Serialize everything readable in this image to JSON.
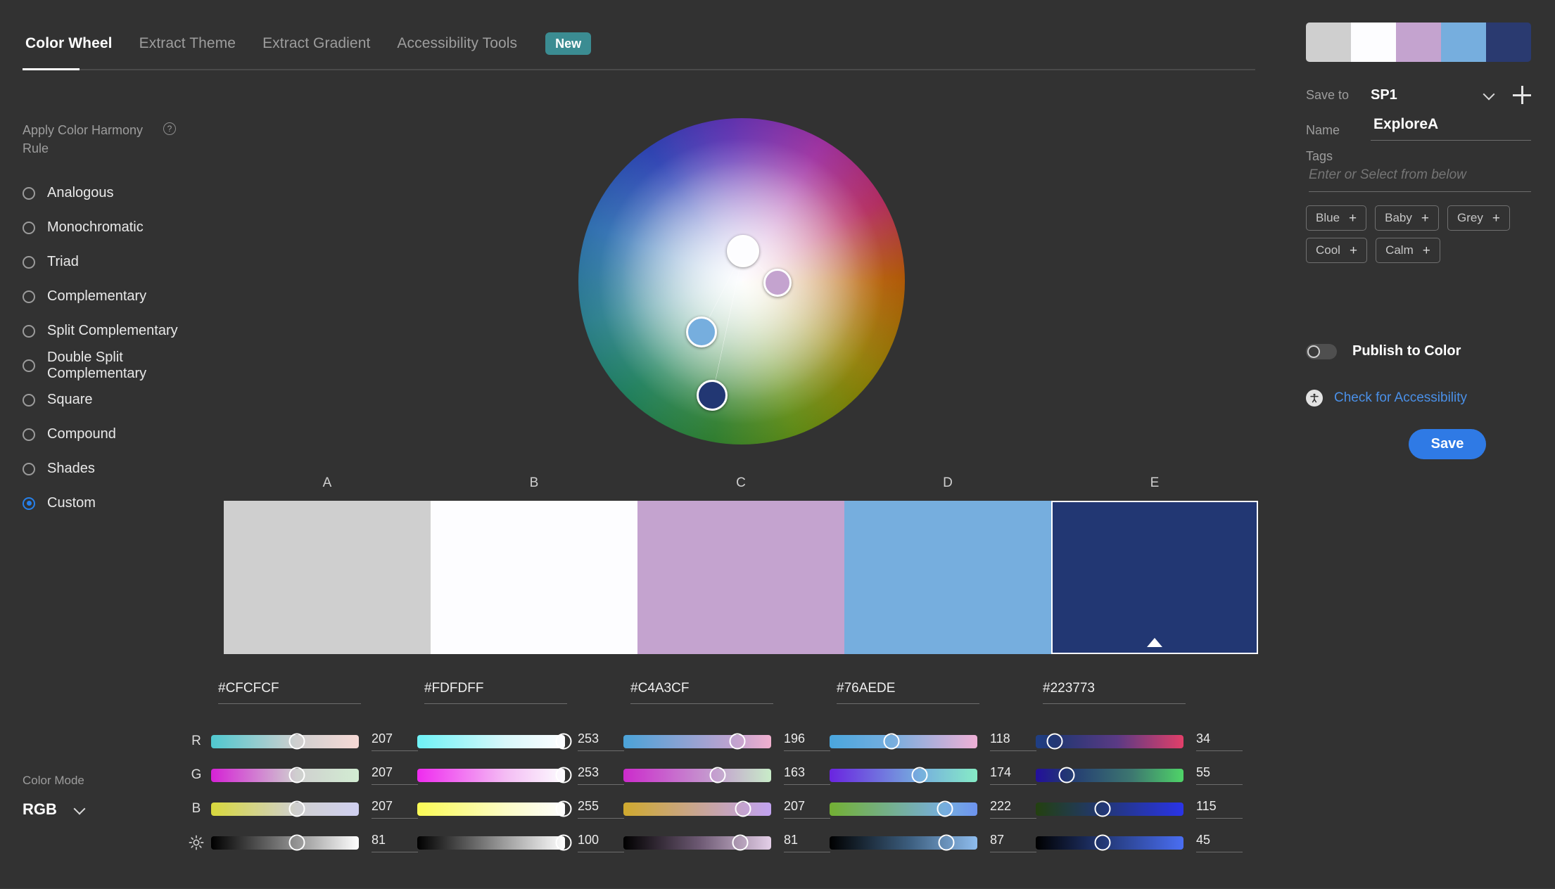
{
  "tabs": [
    {
      "label": "Color Wheel",
      "active": true
    },
    {
      "label": "Extract Theme",
      "active": false
    },
    {
      "label": "Extract Gradient",
      "active": false
    },
    {
      "label": "Accessibility Tools",
      "active": false
    }
  ],
  "tab_badge": "New",
  "harmony": {
    "title": "Apply Color Harmony Rule",
    "help_icon": "?",
    "rules": [
      {
        "label": "Analogous",
        "selected": false
      },
      {
        "label": "Monochromatic",
        "selected": false
      },
      {
        "label": "Triad",
        "selected": false
      },
      {
        "label": "Complementary",
        "selected": false
      },
      {
        "label": "Split Complementary",
        "selected": false
      },
      {
        "label": "Double Split Complementary",
        "selected": false
      },
      {
        "label": "Square",
        "selected": false
      },
      {
        "label": "Compound",
        "selected": false
      },
      {
        "label": "Shades",
        "selected": false
      },
      {
        "label": "Custom",
        "selected": true
      }
    ]
  },
  "color_mode": {
    "label": "Color Mode",
    "value": "RGB"
  },
  "wheel": {
    "markers": [
      {
        "name": "marker-b",
        "x": 50.5,
        "y": 40.8,
        "size": 46,
        "fill": "#fdfdff"
      },
      {
        "name": "marker-c",
        "x": 61.0,
        "y": 50.5,
        "size": 40,
        "fill": "#c4a3cf"
      },
      {
        "name": "marker-d",
        "x": 37.8,
        "y": 65.5,
        "size": 44,
        "fill": "#76aede"
      },
      {
        "name": "marker-e",
        "x": 41.0,
        "y": 85.0,
        "size": 44,
        "fill": "#223773"
      }
    ]
  },
  "swatches": [
    {
      "letter": "A",
      "hex": "#CFCFCF",
      "color": "#cfcfcf",
      "selected": false
    },
    {
      "letter": "B",
      "hex": "#FDFDFF",
      "color": "#fdfdff",
      "selected": false
    },
    {
      "letter": "C",
      "hex": "#C4A3CF",
      "color": "#c4a3cf",
      "selected": false
    },
    {
      "letter": "D",
      "hex": "#76AEDE",
      "color": "#76aede",
      "selected": false
    },
    {
      "letter": "E",
      "hex": "#223773",
      "color": "#223773",
      "selected": true
    }
  ],
  "sliders": {
    "channel_labels": [
      "R",
      "G",
      "B"
    ],
    "brightness_icon": "sun-icon",
    "columns": [
      {
        "letter": "A",
        "values": {
          "R": "207",
          "G": "207",
          "B": "207",
          "brightness": "81"
        },
        "positions": {
          "R": 58,
          "G": 58,
          "B": 58,
          "brightness": 58
        },
        "gradients": {
          "R": "linear-gradient(90deg,#4fc8cf 0%,#cfcfcf 58%,#f6d9d5 100%)",
          "G": "linear-gradient(90deg,#d521d5 0%,#cfcfcf 58%,#d2edd2 100%)",
          "B": "linear-gradient(90deg,#d8d83c 0%,#cfcfcf 58%,#cfcff0 100%)",
          "brightness": "linear-gradient(90deg,#000000 0%,#8c8c8c 55%,#ffffff 100%)"
        }
      },
      {
        "letter": "B",
        "values": {
          "R": "253",
          "G": "253",
          "B": "255",
          "brightness": "100"
        },
        "positions": {
          "R": 99,
          "G": 99,
          "B": 99,
          "brightness": 99
        },
        "gradients": {
          "R": "linear-gradient(90deg,#6ef2f6 0%,#d8f7fa 60%,#fdfdff 100%)",
          "G": "linear-gradient(90deg,#ef2bef 0%,#f4bdf4 60%,#fdfdff 100%)",
          "B": "linear-gradient(90deg,#fafa55 0%,#fcfcc6 60%,#fdfdff 100%)",
          "brightness": "linear-gradient(90deg,#000000 0%,#9a9a9a 58%,#ffffff 100%)"
        }
      },
      {
        "letter": "C",
        "values": {
          "R": "196",
          "G": "163",
          "B": "207",
          "brightness": "81"
        },
        "positions": {
          "R": 77,
          "G": 64,
          "B": 81,
          "brightness": 79
        },
        "gradients": {
          "R": "linear-gradient(90deg,#4ba3d8 0%,#c4a3cf 77%,#f0b0cf 100%)",
          "G": "linear-gradient(90deg,#cc2bcc 0%,#c4a3cf 64%,#c8ecc8 100%)",
          "B": "linear-gradient(90deg,#cfa92e 0%,#c4a3cf 81%,#c2a3f0 100%)",
          "brightness": "linear-gradient(90deg,#000000 0%,#6e5a74 52%,#e4cfe8 100%)"
        }
      },
      {
        "letter": "D",
        "values": {
          "R": "118",
          "G": "174",
          "B": "222",
          "brightness": "87"
        },
        "positions": {
          "R": 42,
          "G": 61,
          "B": 78,
          "brightness": 79
        },
        "gradients": {
          "R": "linear-gradient(90deg,#4aa6dd 0%,#76aede 42%,#efb0d6 100%)",
          "G": "linear-gradient(90deg,#6a24e0 0%,#76aede 61%,#86ecc6 100%)",
          "B": "linear-gradient(90deg,#73b033 0%,#76aede 78%,#6d93ef 100%)",
          "brightness": "linear-gradient(90deg,#000000 0%,#3d5f80 55%,#8fbdee 100%)"
        }
      },
      {
        "letter": "E",
        "values": {
          "R": "34",
          "G": "55",
          "B": "115",
          "brightness": "45"
        },
        "positions": {
          "R": 13,
          "G": 21,
          "B": 45,
          "brightness": 45
        },
        "gradients": {
          "R": "linear-gradient(90deg,#1f3f86 0%,#223773 13%,#5a3a84 55%,#e23f69 100%)",
          "G": "linear-gradient(90deg,#230f9c 0%,#223773 21%,#3d7770 65%,#4fd468 100%)",
          "B": "linear-gradient(90deg,#23400f 0%,#223773 45%,#2a34e8 100%)",
          "brightness": "linear-gradient(90deg,#000000 0%,#223773 45%,#4a6ef2 100%)"
        }
      }
    ]
  },
  "right_panel": {
    "thumb_colors": [
      "#cfcfcf",
      "#fdfdff",
      "#c4a3cf",
      "#76aede",
      "#2a3a70"
    ],
    "save_to_label": "Save to",
    "save_to_value": "SP1",
    "add_icon": "plus-icon",
    "name_label": "Name",
    "name_value": "ExploreA",
    "tags_label": "Tags",
    "tags_placeholder": "Enter or Select from below",
    "tag_chips": [
      "Blue",
      "Baby",
      "Grey",
      "Cool",
      "Calm"
    ],
    "chip_plus": "+",
    "publish_label": "Publish to Color",
    "publish_on": false,
    "accessibility_link": "Check for Accessibility",
    "save_button": "Save",
    "accent_blue": "#2f7ae5",
    "link_blue": "#4a90e8"
  }
}
